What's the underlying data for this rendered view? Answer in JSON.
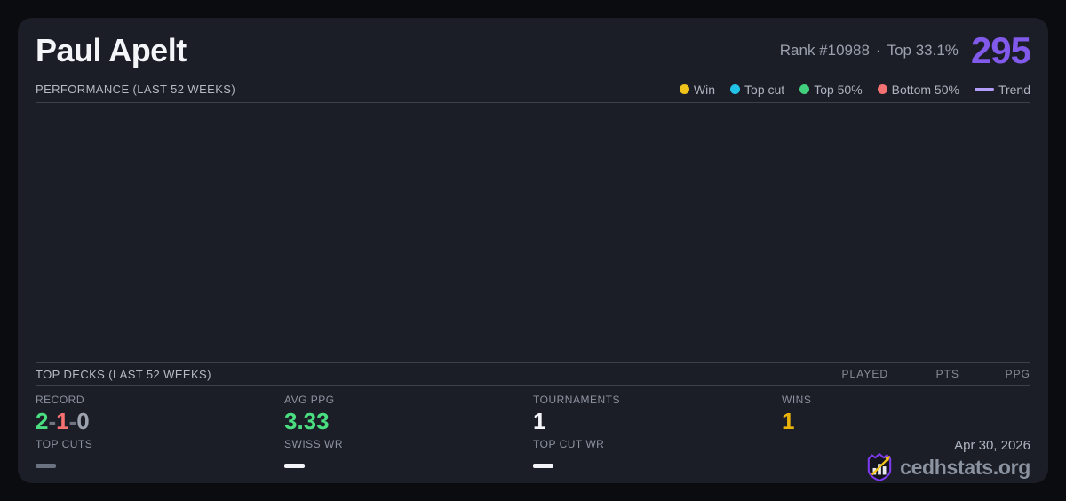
{
  "header": {
    "player_name": "Paul Apelt",
    "rank": "Rank #10988",
    "separator": "·",
    "percentile": "Top 33.1%",
    "score": "295",
    "score_color": "#8159eb"
  },
  "performance": {
    "title": "PERFORMANCE (LAST 52 WEEKS)",
    "legend": [
      {
        "label": "Win",
        "type": "dot",
        "color": "#efc319"
      },
      {
        "label": "Top cut",
        "type": "dot",
        "color": "#22c3e8"
      },
      {
        "label": "Top 50%",
        "type": "dot",
        "color": "#42d07e"
      },
      {
        "label": "Bottom 50%",
        "type": "dot",
        "color": "#f47272"
      },
      {
        "label": "Trend",
        "type": "line",
        "color": "#b39dfa"
      }
    ],
    "points": []
  },
  "top_decks": {
    "title": "TOP DECKS (LAST 52 WEEKS)",
    "columns": [
      "PLAYED",
      "PTS",
      "PPG"
    ],
    "rows": []
  },
  "stats": {
    "record": {
      "label": "RECORD",
      "parts": [
        {
          "text": "2",
          "color": "#4ade80"
        },
        {
          "text": "-",
          "color": "#6e7480"
        },
        {
          "text": "1",
          "color": "#f87171"
        },
        {
          "text": "-",
          "color": "#6e7480"
        },
        {
          "text": "0",
          "color": "#9ca3af"
        }
      ]
    },
    "avg_ppg": {
      "label": "AVG PPG",
      "value": "3.33",
      "color": "#4ade80"
    },
    "tournaments": {
      "label": "TOURNAMENTS",
      "value": "1",
      "color": "#f5f6fa"
    },
    "wins": {
      "label": "WINS",
      "value": "1",
      "color": "#eab308"
    },
    "top_cuts": {
      "label": "TOP CUTS",
      "value": "—",
      "dash_color": "#6b7280"
    },
    "swiss_wr": {
      "label": "SWISS WR",
      "value": "—",
      "dash_color": "#f2f4f8"
    },
    "top_cut_wr": {
      "label": "TOP CUT WR",
      "value": "—",
      "dash_color": "#f2f4f8"
    }
  },
  "footer": {
    "date": "Apr 30, 2026",
    "brand": "cedhstats.org"
  },
  "colors": {
    "page_bg": "#0b0c10",
    "card_bg": "#1b1e27",
    "divider": "#3b404d",
    "accent_purple": "#8159eb"
  }
}
